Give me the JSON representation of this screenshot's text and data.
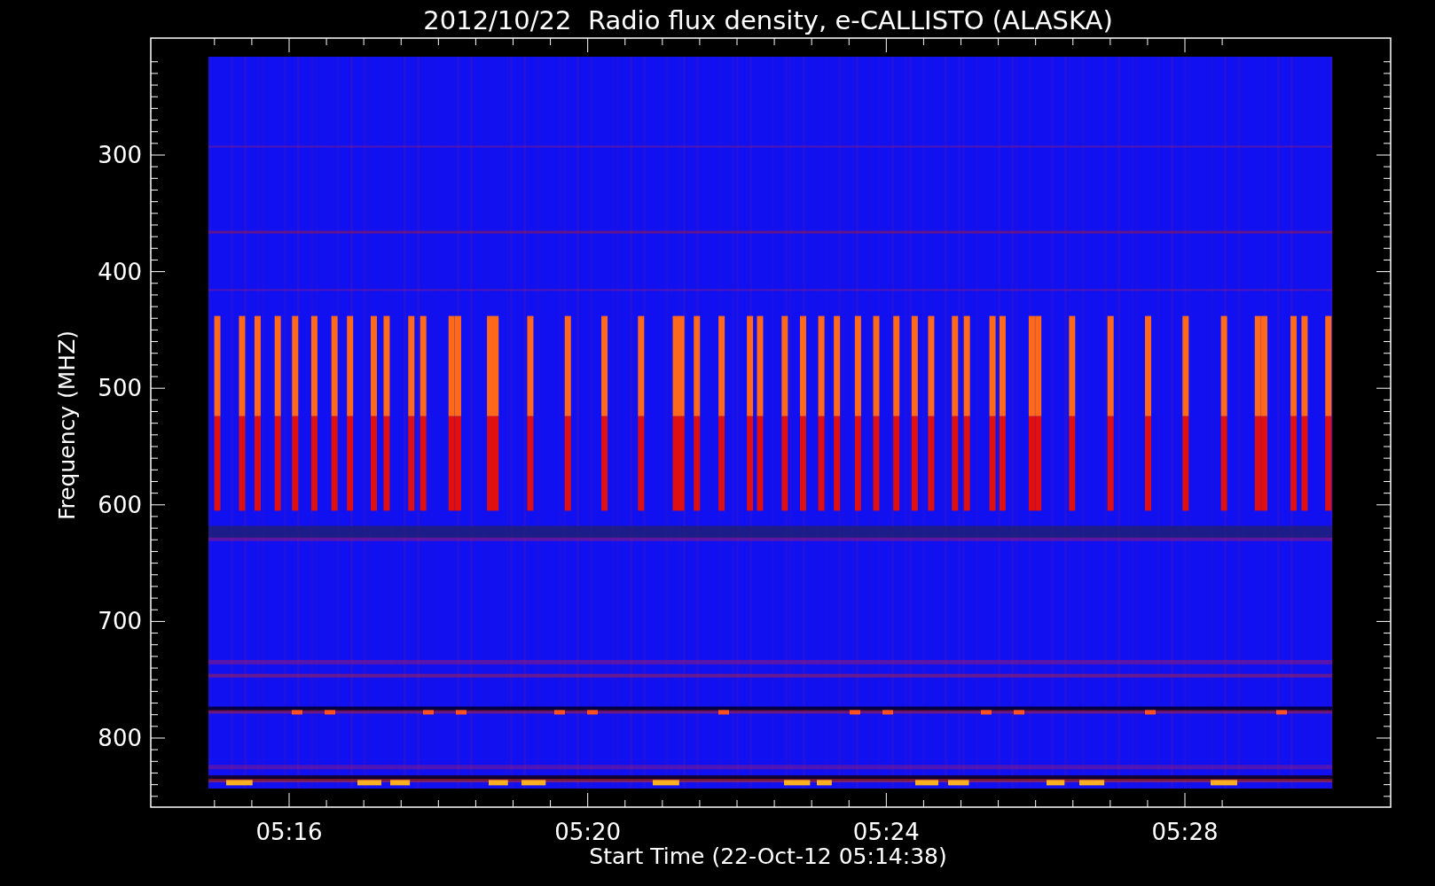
{
  "title": "2012/10/22  Radio flux density, e-CALLISTO (ALASKA)",
  "plot": {
    "y_axis": {
      "label": "Frequency (MHZ)",
      "ticks": [
        "300",
        "400",
        "500",
        "600",
        "700",
        "800"
      ]
    },
    "x_axis": {
      "label": "Start Time (22-Oct-12 05:14:38)",
      "ticks": [
        "05:16",
        "05:20",
        "05:24",
        "05:28"
      ]
    }
  }
}
